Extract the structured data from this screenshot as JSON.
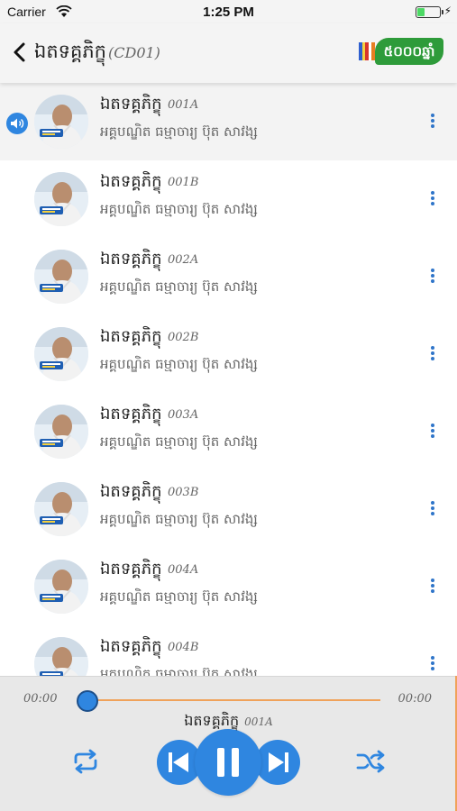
{
  "status_bar": {
    "carrier": "Carrier",
    "time": "1:25 PM",
    "battery_level": 0.35
  },
  "nav": {
    "title": "ឯតទគ្គភិក្ខុ",
    "subtitle": "(CD01)",
    "logo_text": "៥០០០ឆ្នាំ"
  },
  "tracks": [
    {
      "title": "ឯតទគ្គភិក្ខុ",
      "code": "001A",
      "artist": "អគ្គបណ្ឌិត ធម្មាចារ្យ ប៊ុត សាវង្ស",
      "active": true
    },
    {
      "title": "ឯតទគ្គភិក្ខុ",
      "code": "001B",
      "artist": "អគ្គបណ្ឌិត ធម្មាចារ្យ ប៊ុត សាវង្ស",
      "active": false
    },
    {
      "title": "ឯតទគ្គភិក្ខុ",
      "code": "002A",
      "artist": "អគ្គបណ្ឌិត ធម្មាចារ្យ ប៊ុត សាវង្ស",
      "active": false
    },
    {
      "title": "ឯតទគ្គភិក្ខុ",
      "code": "002B",
      "artist": "អគ្គបណ្ឌិត ធម្មាចារ្យ ប៊ុត សាវង្ស",
      "active": false
    },
    {
      "title": "ឯតទគ្គភិក្ខុ",
      "code": "003A",
      "artist": "អគ្គបណ្ឌិត ធម្មាចារ្យ ប៊ុត សាវង្ស",
      "active": false
    },
    {
      "title": "ឯតទគ្គភិក្ខុ",
      "code": "003B",
      "artist": "អគ្គបណ្ឌិត ធម្មាចារ្យ ប៊ុត សាវង្ស",
      "active": false
    },
    {
      "title": "ឯតទគ្គភិក្ខុ",
      "code": "004A",
      "artist": "អគ្គបណ្ឌិត ធម្មាចារ្យ ប៊ុត សាវង្ស",
      "active": false
    },
    {
      "title": "ឯតទគ្គភិក្ខុ",
      "code": "004B",
      "artist": "អគ្គបណ្ឌិត ធម្មាចារ្យ ប៊ុត សាវង្ស",
      "active": false
    }
  ],
  "player": {
    "elapsed": "00:00",
    "total": "00:00",
    "progress": 0,
    "now_playing_title": "ឯតទគ្គភិក្ខុ",
    "now_playing_code": "001A"
  },
  "icons": {
    "back": "chevron-left-icon",
    "more": "more-vertical-icon",
    "speaker": "speaker-icon",
    "repeat": "repeat-icon",
    "shuffle": "shuffle-icon",
    "previous": "skip-previous-icon",
    "pause": "pause-icon",
    "next": "skip-next-icon"
  },
  "colors": {
    "accent_blue": "#2f86e0",
    "progress_orange": "#f0a25a",
    "logo_green": "#2e9b3a"
  }
}
